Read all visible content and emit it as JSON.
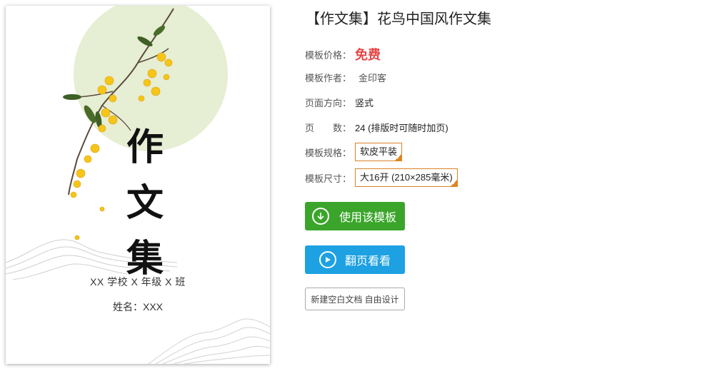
{
  "cover": {
    "title_chars": [
      "作",
      "文",
      "集"
    ],
    "school_line": "XX 学校 X 年级 X 班",
    "name_line": "姓名：XXX"
  },
  "template": {
    "title": "【作文集】花鸟中国风作文集",
    "price_label": "模板价格：",
    "price_value": "免费",
    "author_label": "模板作者：",
    "author_value": "金印客",
    "orientation_label": "页面方向：",
    "orientation_value": "竖式",
    "pages_label": "页　　数：",
    "pages_value": "24 (排版时可随时加页)",
    "spec_label": "模板规格：",
    "spec_value": "软皮平装",
    "size_label": "模板尺寸：",
    "size_value": "大16开 (210×285毫米)"
  },
  "buttons": {
    "use_template": "使用该模板",
    "flip_preview": "翻页看看",
    "new_blank": "新建空白文档 自由设计"
  },
  "colors": {
    "price": "#e64545",
    "use_button": "#3aa52a",
    "flip_button": "#1da1e2",
    "spec_border": "#d9822b",
    "moon": "#e6eed3",
    "blossom": "#f5c518"
  },
  "icons": {
    "use_template": "download-circle-icon",
    "flip_preview": "play-circle-icon",
    "spec_selected": "check-corner-icon"
  }
}
